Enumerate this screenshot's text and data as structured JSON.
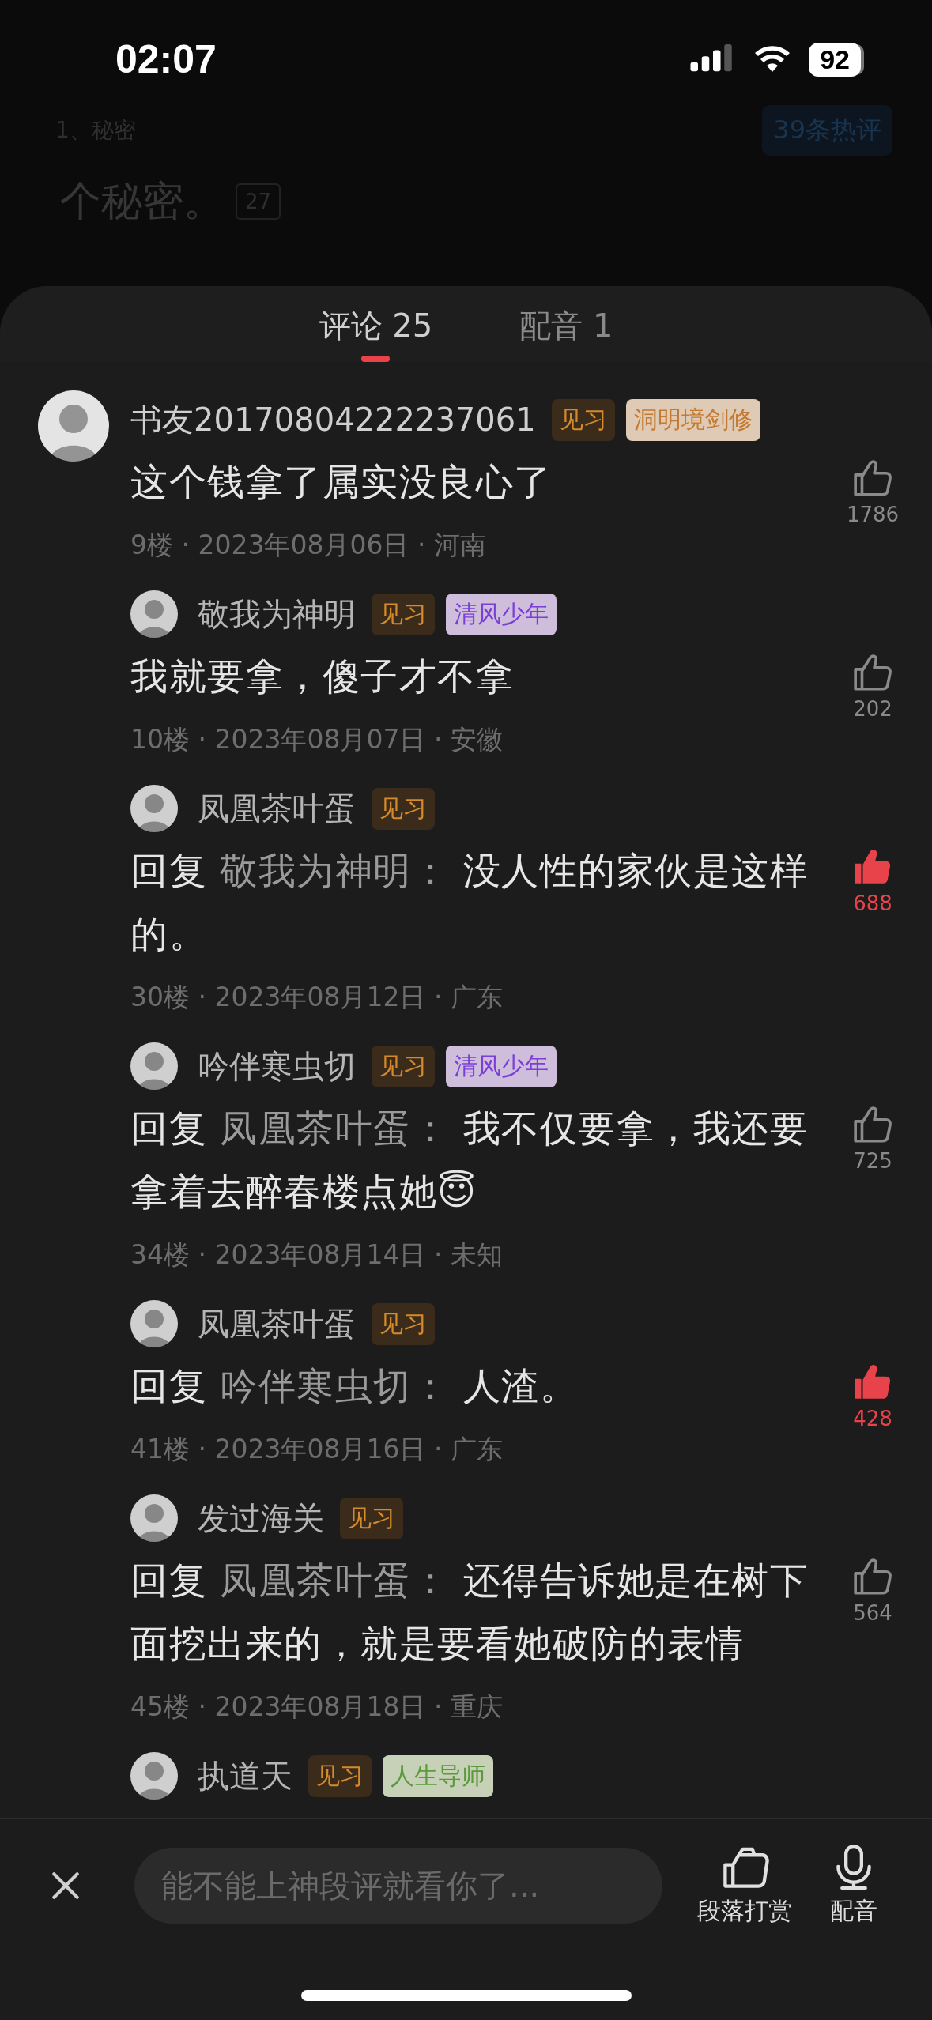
{
  "status_bar": {
    "time": "02:07",
    "battery": "92"
  },
  "background_page": {
    "chapter": "1、秘密",
    "hot_comments": "39条热评",
    "line": "个秘密。",
    "line_comment_count": "27"
  },
  "tabs": [
    {
      "label": "评论 25",
      "selected": true
    },
    {
      "label": "配音 1",
      "selected": false
    }
  ],
  "comments": [
    {
      "kind": "comment",
      "user": "书友20170804222237061",
      "badges": [
        {
          "kind": "level",
          "label": "见习"
        },
        {
          "kind": "honor",
          "label": "洞明境剑修",
          "color": "#c47a30"
        }
      ],
      "text": "这个钱拿了属实没良心了",
      "meta": "9楼 · 2023年08月06日 · 河南",
      "likes": "1786",
      "liked": false
    },
    {
      "kind": "reply",
      "user": "敬我为神明",
      "badges": [
        {
          "kind": "level",
          "label": "见习"
        },
        {
          "kind": "honor",
          "label": "清风少年",
          "color": "#7b3fd8"
        }
      ],
      "text": "我就要拿，傻子才不拿",
      "meta": "10楼 · 2023年08月07日 · 安徽",
      "likes": "202",
      "liked": false
    },
    {
      "kind": "reply",
      "user": "凤凰茶叶蛋",
      "badges": [
        {
          "kind": "level",
          "label": "见习"
        }
      ],
      "reply_label": "回复",
      "reply_to": "敬我为神明",
      "reply_sep": "：",
      "text": "没人性的家伙是这样的。",
      "meta": "30楼 · 2023年08月12日 · 广东",
      "likes": "688",
      "liked": true
    },
    {
      "kind": "reply",
      "user": "吟伴寒虫切",
      "badges": [
        {
          "kind": "level",
          "label": "见习"
        },
        {
          "kind": "honor",
          "label": "清风少年",
          "color": "#7b3fd8"
        }
      ],
      "reply_label": "回复",
      "reply_to": "凤凰茶叶蛋",
      "reply_sep": "：",
      "text": "我不仅要拿，我还要拿着去醉春楼点她😇",
      "meta": "34楼 · 2023年08月14日 · 未知",
      "likes": "725",
      "liked": false
    },
    {
      "kind": "reply",
      "user": "凤凰茶叶蛋",
      "badges": [
        {
          "kind": "level",
          "label": "见习"
        }
      ],
      "reply_label": "回复",
      "reply_to": "吟伴寒虫切",
      "reply_sep": "：",
      "text": "人渣。",
      "meta": "41楼 · 2023年08月16日 · 广东",
      "likes": "428",
      "liked": true
    },
    {
      "kind": "reply",
      "user": "发过海关",
      "badges": [
        {
          "kind": "level",
          "label": "见习"
        }
      ],
      "reply_label": "回复",
      "reply_to": "凤凰茶叶蛋",
      "reply_sep": "：",
      "text": "还得告诉她是在树下面挖出来的，就是要看她破防的表情",
      "meta": "45楼 · 2023年08月18日 · 重庆",
      "likes": "564",
      "liked": false
    },
    {
      "kind": "reply",
      "user": "执道天",
      "badges": [
        {
          "kind": "level",
          "label": "见习"
        },
        {
          "kind": "honor",
          "label": "人生导师",
          "color": "#5a9a3a"
        }
      ]
    }
  ],
  "composer": {
    "placeholder": "能不能上神段评就看你了...",
    "actions": [
      {
        "kind": "reward",
        "label": "段落打赏"
      },
      {
        "kind": "voice",
        "label": "配音"
      }
    ]
  }
}
